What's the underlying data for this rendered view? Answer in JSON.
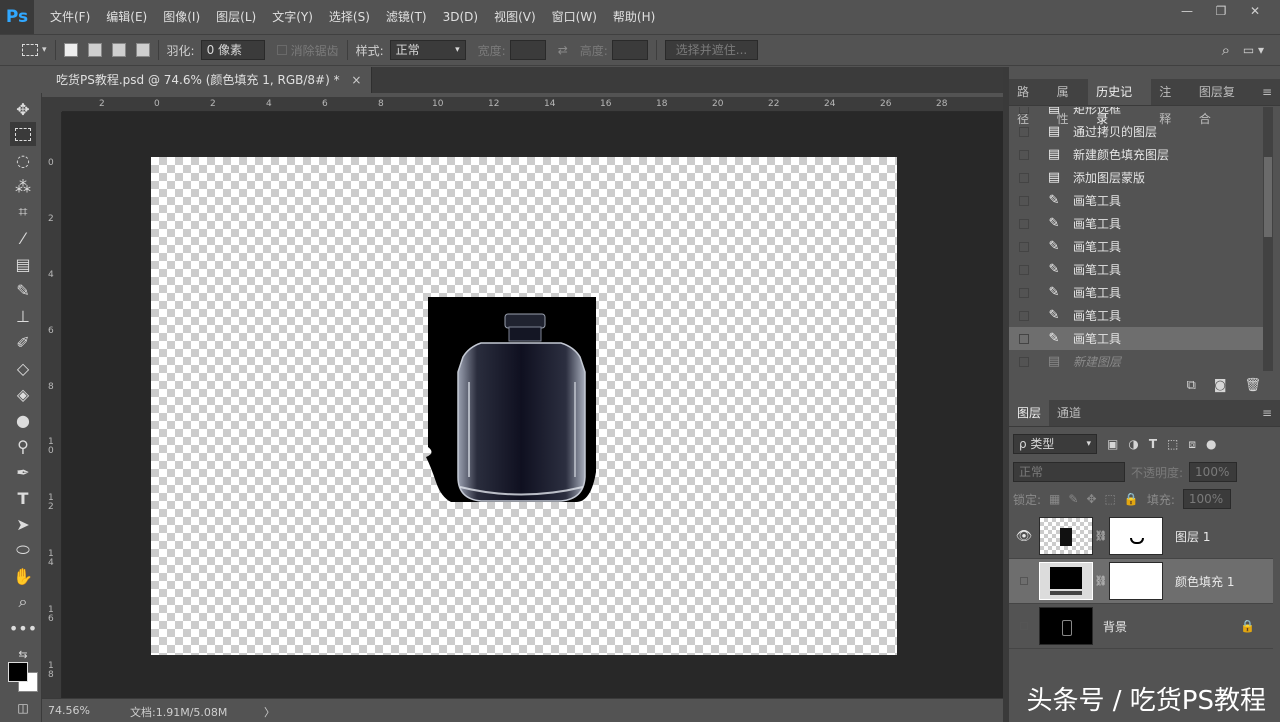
{
  "app": {
    "logo": "Ps"
  },
  "menu": [
    "文件(F)",
    "编辑(E)",
    "图像(I)",
    "图层(L)",
    "文字(Y)",
    "选择(S)",
    "滤镜(T)",
    "3D(D)",
    "视图(V)",
    "窗口(W)",
    "帮助(H)"
  ],
  "window_controls": [
    "minimize-icon",
    "restore-icon",
    "close-icon"
  ],
  "options": {
    "feather_label": "羽化:",
    "feather_value": "0 像素",
    "antialias_label": "消除锯齿",
    "style_label": "样式:",
    "style_value": "正常",
    "width_label": "宽度:",
    "height_label": "高度:",
    "select_mask_label": "选择并遮住..."
  },
  "document": {
    "tab_title": "吃货PS教程.psd @ 74.6% (颜色填充 1, RGB/8#) *",
    "close_glyph": "×"
  },
  "ruler": {
    "h_ticks": [
      "2",
      "0",
      "2",
      "4",
      "6",
      "8",
      "10",
      "12",
      "14",
      "16",
      "18",
      "20",
      "22",
      "24",
      "26",
      "28"
    ],
    "v_ticks": [
      "0",
      "2",
      "4",
      "6",
      "8",
      "1\n0",
      "1\n2",
      "1\n4",
      "1\n6",
      "1\n8"
    ]
  },
  "status": {
    "zoom": "74.56%",
    "doc_info": "文档:1.91M/5.08M",
    "arrow": "〉"
  },
  "history_panel": {
    "tabs": [
      "路径",
      "属性",
      "历史记录",
      "注释",
      "图层复合"
    ],
    "active_tab": "历史记录",
    "items": [
      {
        "label": "矩形选框",
        "icon": "doc-icon"
      },
      {
        "label": "通过拷贝的图层",
        "icon": "doc-icon"
      },
      {
        "label": "新建颜色填充图层",
        "icon": "doc-icon"
      },
      {
        "label": "添加图层蒙版",
        "icon": "doc-icon"
      },
      {
        "label": "画笔工具",
        "icon": "brush-icon"
      },
      {
        "label": "画笔工具",
        "icon": "brush-icon"
      },
      {
        "label": "画笔工具",
        "icon": "brush-icon"
      },
      {
        "label": "画笔工具",
        "icon": "brush-icon"
      },
      {
        "label": "画笔工具",
        "icon": "brush-icon"
      },
      {
        "label": "画笔工具",
        "icon": "brush-icon"
      },
      {
        "label": "画笔工具",
        "icon": "brush-icon"
      },
      {
        "label": "新建图层",
        "icon": "doc-icon"
      }
    ]
  },
  "layers_panel": {
    "tabs": [
      "图层",
      "通道"
    ],
    "active_tab": "图层",
    "filter_label": "ρ 类型",
    "blend_mode": "正常",
    "opacity_label": "不透明度:",
    "opacity_value": "100%",
    "lock_label": "锁定:",
    "fill_label": "填充:",
    "fill_value": "100%",
    "layers": [
      {
        "name": "图层 1",
        "visible": true
      },
      {
        "name": "颜色填充 1",
        "visible": false,
        "selected": true
      },
      {
        "name": "背景",
        "visible": false,
        "locked": true
      }
    ]
  },
  "watermark": "头条号 / 吃货PS教程",
  "colors": {
    "ui_bg": "#535353",
    "canvas_bg": "#282828",
    "accent": "#31a8ff"
  }
}
